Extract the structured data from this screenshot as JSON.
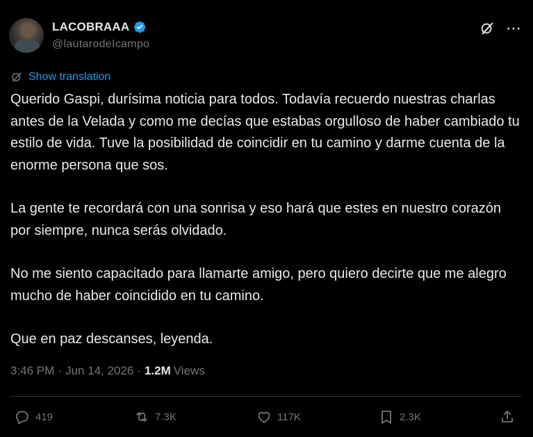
{
  "user": {
    "display_name": "LACOBRAAA",
    "handle": "@lautarodeIcampo"
  },
  "translation": {
    "label": "Show translation"
  },
  "post": {
    "paragraphs": [
      "Querido Gaspi, durísima noticia para todos. Todavía recuerdo nuestras charlas antes de la Velada y como me decías que estabas orgulloso de haber cambiado tu estilo de vida. Tuve la posibilidad de coincidir en tu camino y darme cuenta de la enorme persona que sos.",
      "La gente te recordará con una sonrisa y eso hará que estes en nuestro corazón por siempre, nunca serás olvidado.",
      "No me siento capacitado para llamarte amigo, pero quiero decirte que me alegro mucho de haber coincidido en tu camino.",
      "Que en paz descanses, leyenda."
    ]
  },
  "meta": {
    "time": "3:46 PM",
    "separator": "·",
    "date": "Jun 14, 2026",
    "views_count": "1.2M",
    "views_label": "Views"
  },
  "actions": {
    "replies": "419",
    "reposts": "7.3K",
    "likes": "117K",
    "bookmarks": "2.3K"
  },
  "icons": {
    "verified": "verified-badge-icon",
    "grok": "grok-icon",
    "more": "more-icon",
    "translate": "translate-icon",
    "reply": "reply-icon",
    "repost": "repost-icon",
    "like": "heart-icon",
    "bookmark": "bookmark-icon",
    "share": "share-icon"
  },
  "colors": {
    "background": "#000000",
    "text": "#e7e9ea",
    "muted": "#71767b",
    "accent": "#1d9bf0",
    "divider": "#2f3336"
  }
}
